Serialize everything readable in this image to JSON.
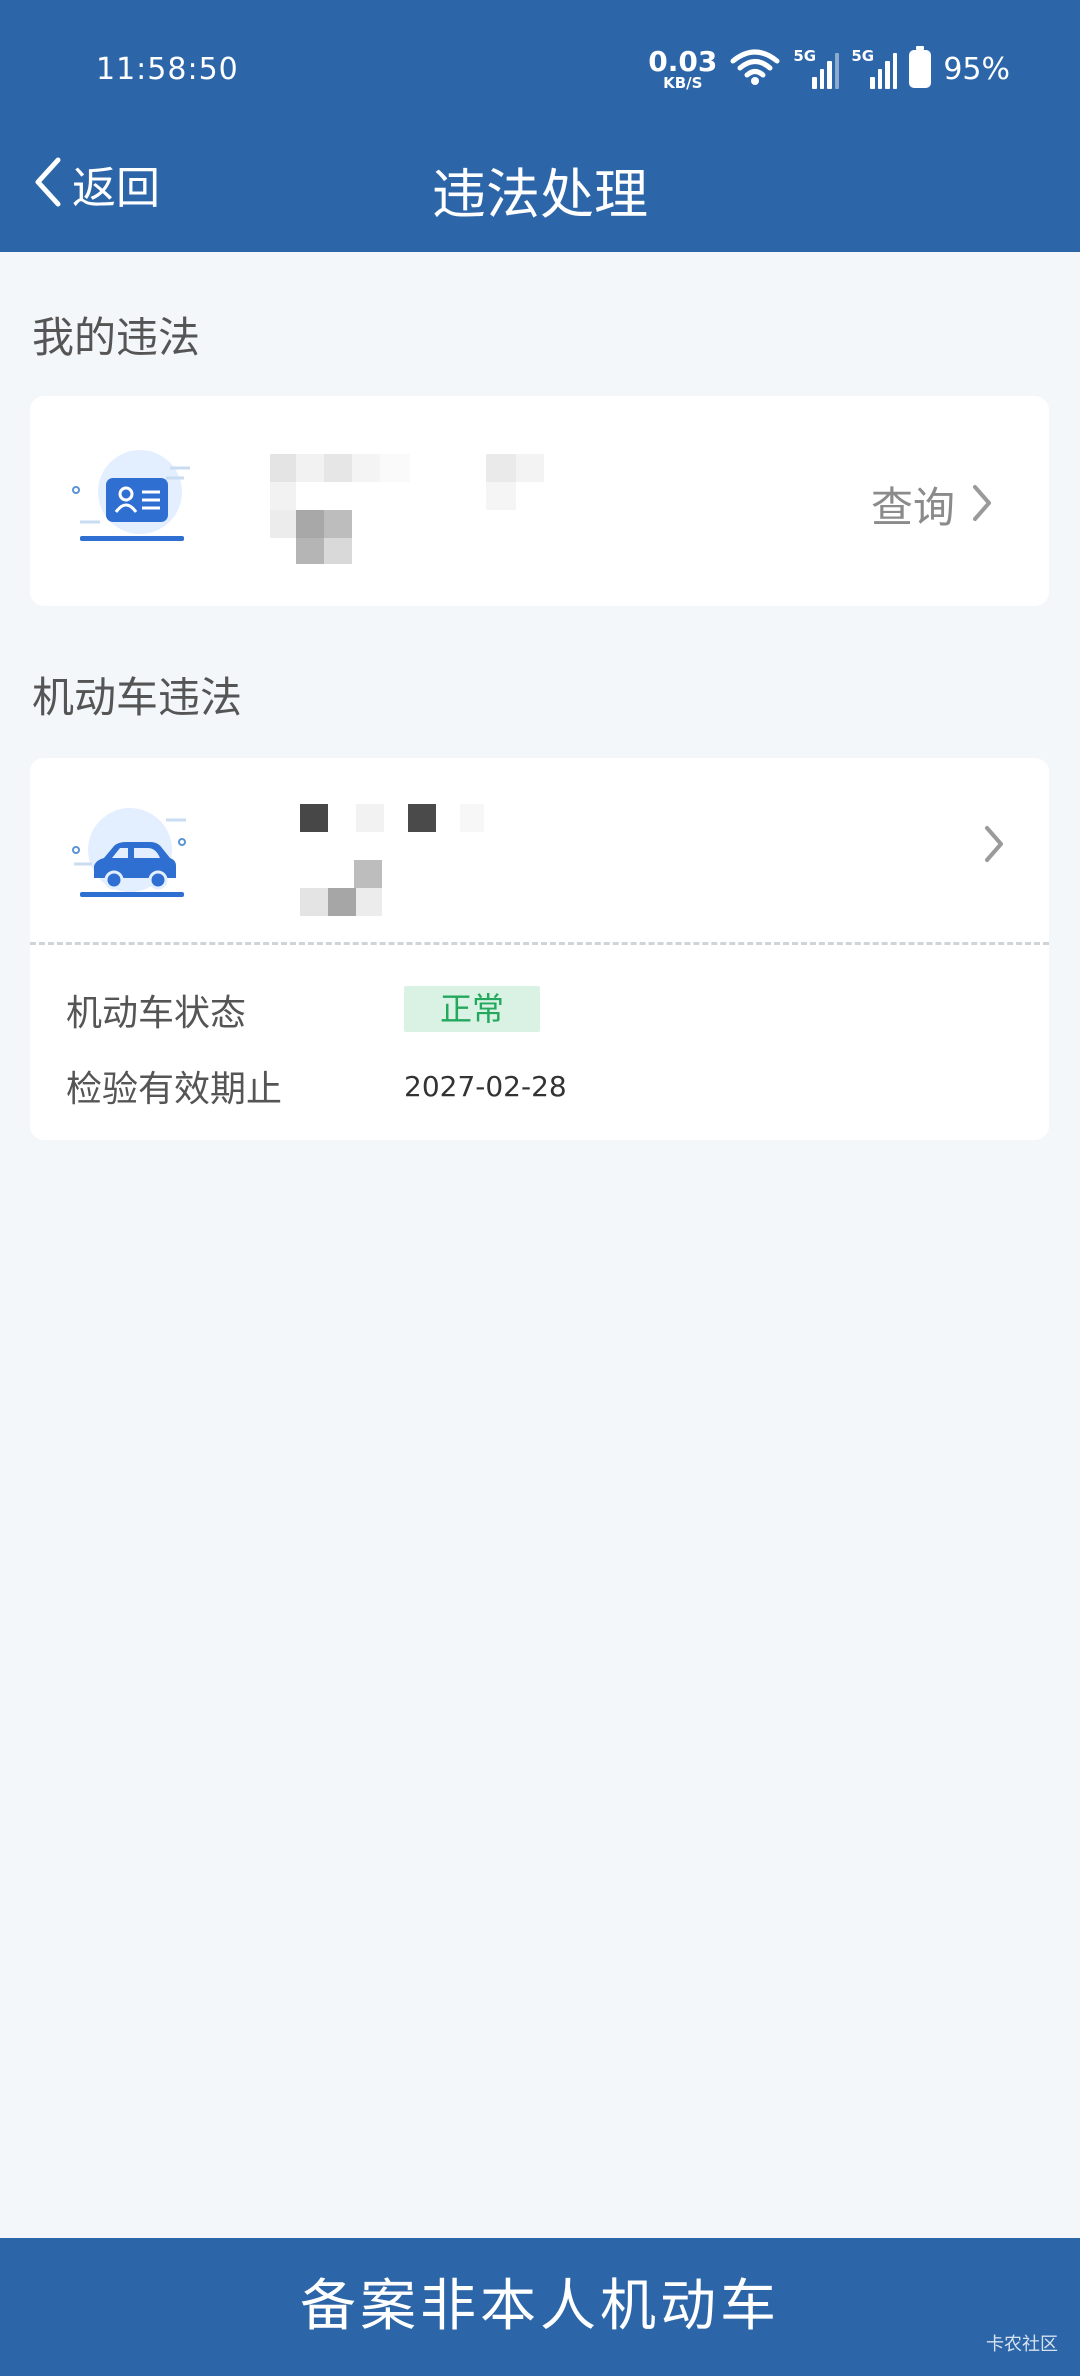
{
  "status_bar": {
    "time": "11:58:50",
    "net_speed": "0.03",
    "net_unit": "KB/S",
    "signal_tag": "5G",
    "battery": "95%"
  },
  "header": {
    "back_label": "返回",
    "title": "违法处理"
  },
  "my_violations": {
    "section_title": "我的违法",
    "query_label": "查询"
  },
  "vehicle_violations": {
    "section_title": "机动车违法",
    "status_label": "机动车状态",
    "status_value": "正常",
    "inspection_label": "检验有效期止",
    "inspection_date": "2027-02-28"
  },
  "bottom_button": "备案非本人机动车",
  "watermark": "卡农社区",
  "colors": {
    "primary": "#2d66a8",
    "status_ok_bg": "#d9f2e4",
    "status_ok_text": "#23a85e"
  }
}
